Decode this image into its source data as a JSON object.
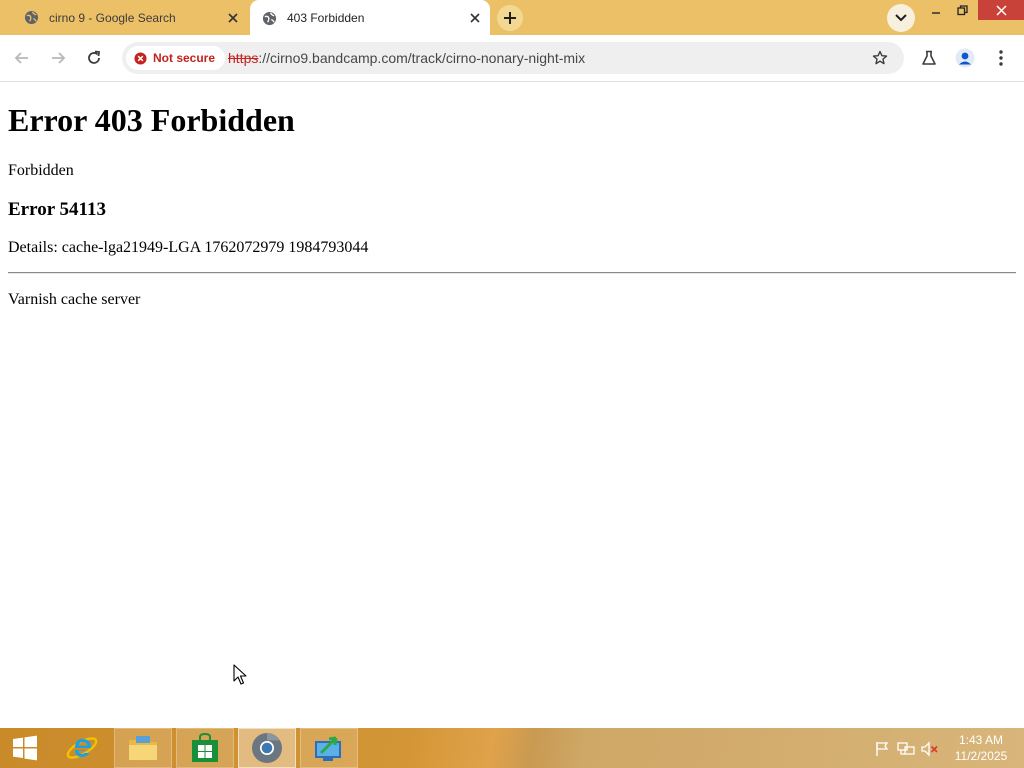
{
  "browser": {
    "tabs": [
      {
        "label": "cirno 9 - Google Search",
        "active": false
      },
      {
        "label": "403 Forbidden",
        "active": true
      }
    ],
    "address_bar": {
      "security_label": "Not secure",
      "url_scheme": "https",
      "url_rest": "://cirno9.bandcamp.com/track/cirno-nonary-night-mix"
    },
    "colors": {
      "tab_strip": "#ecc066",
      "warning_red": "#c5221f",
      "close_red": "#c9423a"
    }
  },
  "page": {
    "heading": "Error 403 Forbidden",
    "message": "Forbidden",
    "error_code": "Error 54113",
    "details": "Details: cache-lga21949-LGA 1762072979 1984793044",
    "footer": "Varnish cache server"
  },
  "taskbar": {
    "apps": [
      "start",
      "internet-explorer",
      "file-explorer",
      "store",
      "chrome",
      "remote-app"
    ],
    "clock": {
      "time": "1:43 AM",
      "date": "11/2/2025"
    }
  }
}
